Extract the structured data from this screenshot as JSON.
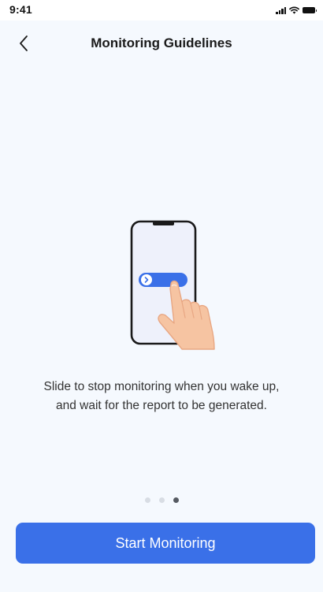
{
  "status_bar": {
    "time": "9:41",
    "icons": [
      "signal-icon",
      "wifi-icon",
      "battery-icon"
    ]
  },
  "header": {
    "back_icon": "chevron-left-icon",
    "title": "Monitoring Guidelines"
  },
  "illustration": {
    "description_icon": "phone-swipe-illustration",
    "colors": {
      "phone_frame": "#1a1a1a",
      "phone_screen": "#eef1fb",
      "slider": "#3a70e8",
      "hand": "#f6c4a2"
    }
  },
  "guide": {
    "line1": "Slide to stop monitoring when you wake up,",
    "line2": "and wait for the report to be generated."
  },
  "pager": {
    "total": 3,
    "current": 3
  },
  "actions": {
    "start_label": "Start Monitoring"
  },
  "colors": {
    "background": "#f5f9fe",
    "accent": "#3a70e8",
    "text_primary": "#1a1a1a",
    "text_secondary": "#333333"
  }
}
